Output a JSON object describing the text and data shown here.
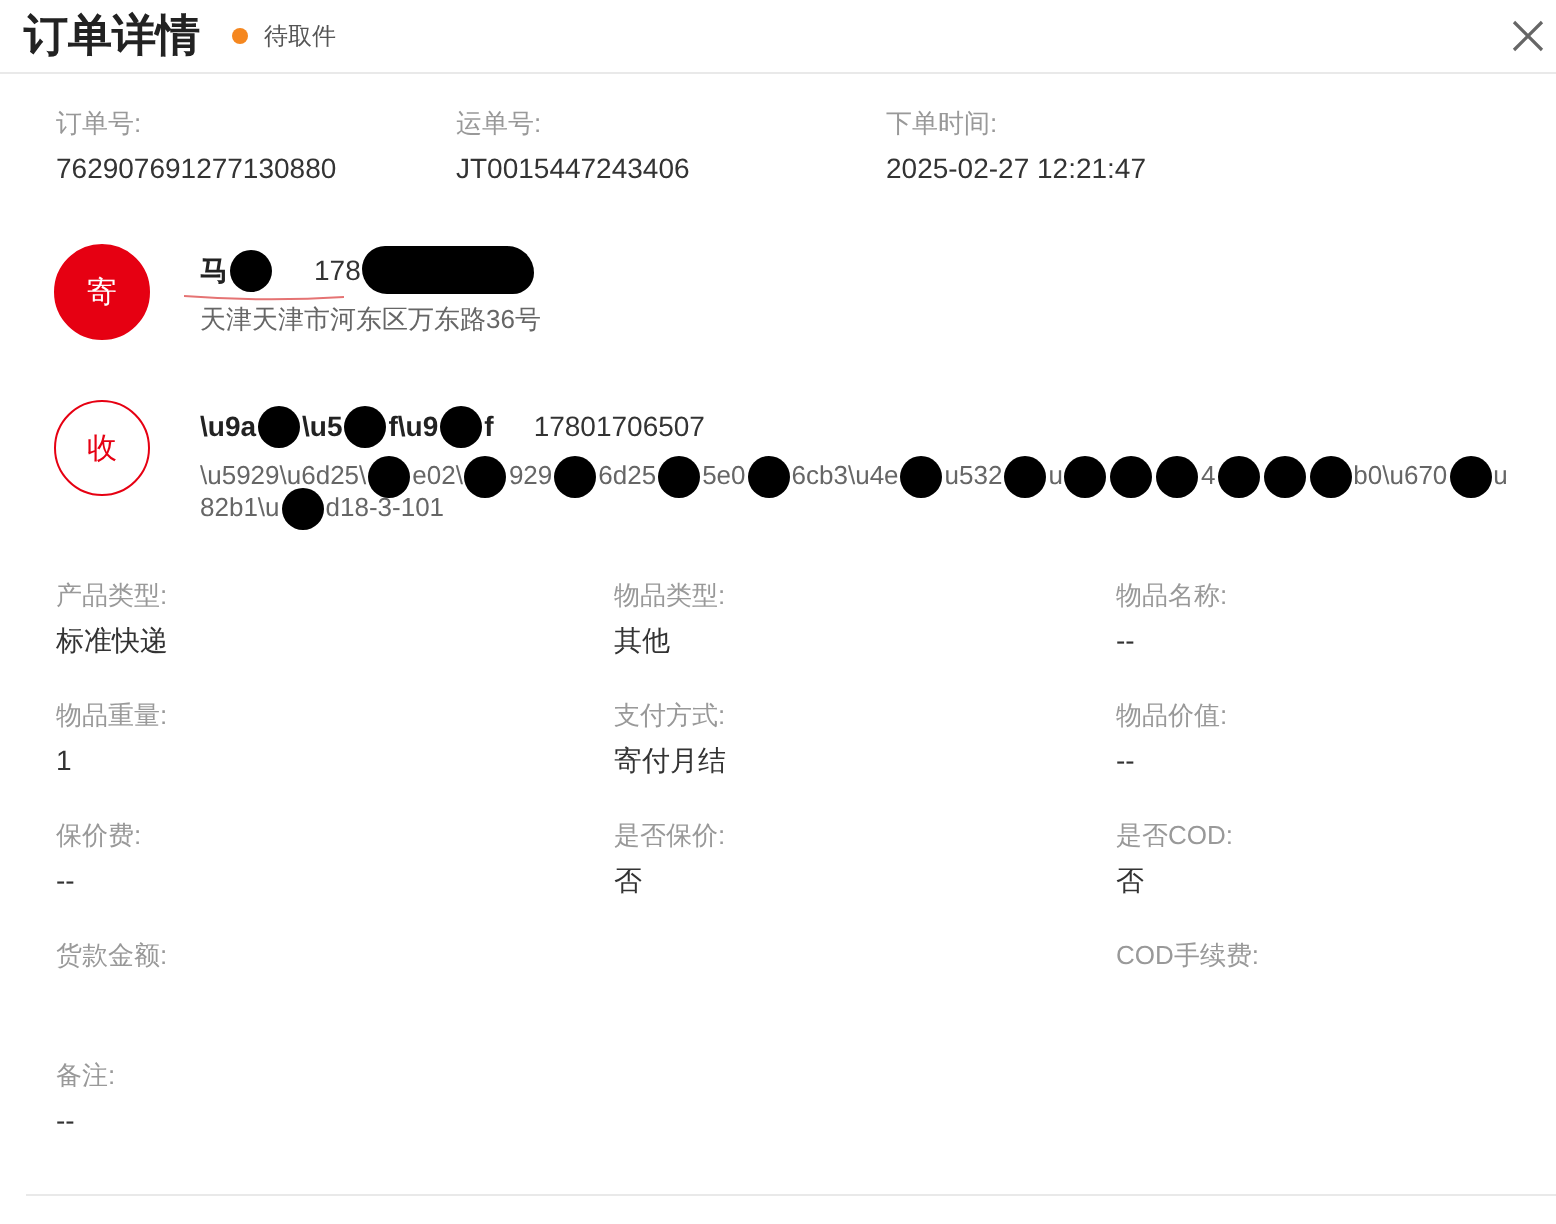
{
  "window": {
    "title": "订单详情",
    "status": "待取件"
  },
  "order_info": [
    {
      "label": "订单号:",
      "value": "762907691277130880"
    },
    {
      "label": "运单号:",
      "value": "JT0015447243406"
    },
    {
      "label": "下单时间:",
      "value": "2025-02-27 12:21:47"
    }
  ],
  "parties": [
    {
      "kind": "sender",
      "badge": "寄",
      "underlined": true,
      "name_parts": [
        {
          "kind": "text",
          "text": "马"
        },
        {
          "kind": "redaction"
        }
      ],
      "phone_parts": [
        {
          "kind": "text",
          "text": "178"
        },
        {
          "kind": "long_redaction"
        }
      ],
      "address_lines": [
        [
          {
            "kind": "text",
            "text": "天津天津市河东区万东路36号"
          }
        ]
      ]
    },
    {
      "kind": "receiver",
      "badge": "收",
      "underlined": false,
      "name_parts": [
        {
          "kind": "text",
          "text": "\\u9a"
        },
        {
          "kind": "redaction"
        },
        {
          "kind": "text",
          "text": "\\u5"
        },
        {
          "kind": "redaction"
        },
        {
          "kind": "text",
          "text": "f\\u9"
        },
        {
          "kind": "redaction"
        },
        {
          "kind": "text",
          "text": "f"
        }
      ],
      "phone_parts": [
        {
          "kind": "text",
          "text": "17801706507"
        }
      ],
      "address_lines": [
        [
          {
            "kind": "text",
            "text": "\\u5929\\u6d25\\"
          },
          {
            "kind": "redaction"
          },
          {
            "kind": "text",
            "text": "e02\\"
          },
          {
            "kind": "redaction"
          },
          {
            "kind": "text",
            "text": "929"
          },
          {
            "kind": "redaction"
          },
          {
            "kind": "text",
            "text": "6d25"
          },
          {
            "kind": "redaction"
          },
          {
            "kind": "text",
            "text": "5e0"
          },
          {
            "kind": "redaction"
          },
          {
            "kind": "text",
            "text": "6cb3\\u4e"
          },
          {
            "kind": "redaction"
          },
          {
            "kind": "text",
            "text": "u532"
          },
          {
            "kind": "redaction"
          },
          {
            "kind": "text",
            "text": "u"
          },
          {
            "kind": "redaction"
          },
          {
            "kind": "redaction"
          },
          {
            "kind": "redaction"
          },
          {
            "kind": "text",
            "text": "4"
          },
          {
            "kind": "redaction"
          },
          {
            "kind": "redaction"
          },
          {
            "kind": "redaction"
          },
          {
            "kind": "text",
            "text": "b0\\u670"
          },
          {
            "kind": "redaction"
          },
          {
            "kind": "text",
            "text": "u"
          }
        ],
        [
          {
            "kind": "text",
            "text": "82b1\\u"
          },
          {
            "kind": "redaction"
          },
          {
            "kind": "text",
            "text": "d18-3-101"
          }
        ]
      ]
    }
  ],
  "detail_columns": [
    [
      {
        "label": "产品类型:",
        "value": "标准快递"
      },
      {
        "label": "物品重量:",
        "value": "1"
      },
      {
        "label": "保价费:",
        "value": "--"
      },
      {
        "label": "货款金额:"
      },
      {
        "label": "备注:",
        "value": "--"
      }
    ],
    [
      {
        "label": "物品类型:",
        "value": "其他"
      },
      {
        "label": "支付方式:",
        "value": "寄付月结"
      },
      {
        "label": "是否保价:",
        "value": "否"
      }
    ],
    [
      {
        "label": "物品名称:",
        "value": "--"
      },
      {
        "label": "物品价值:",
        "value": "--"
      },
      {
        "label": "是否COD:",
        "value": "否"
      },
      {
        "label": "COD手续费:"
      }
    ]
  ]
}
